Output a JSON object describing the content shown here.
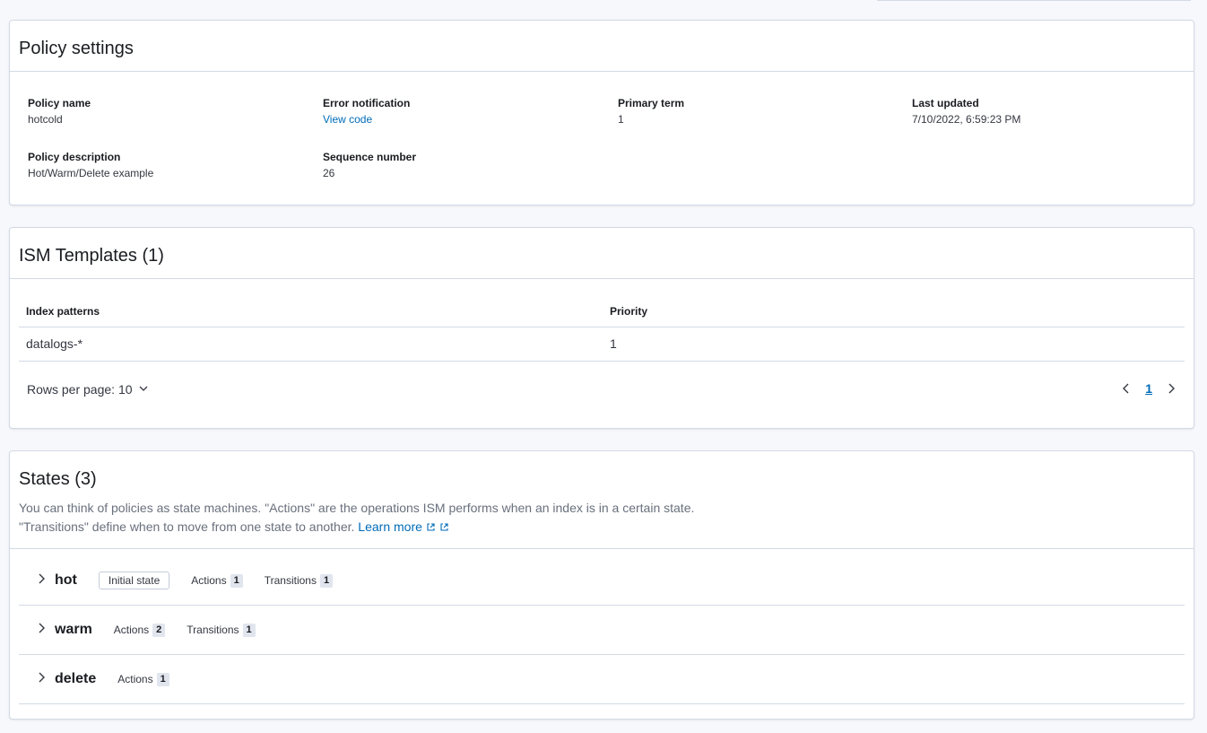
{
  "policy_settings": {
    "title": "Policy settings",
    "fields": {
      "policy_name": {
        "label": "Policy name",
        "value": "hotcold"
      },
      "error_notification": {
        "label": "Error notification",
        "value": "View code"
      },
      "primary_term": {
        "label": "Primary term",
        "value": "1"
      },
      "last_updated": {
        "label": "Last updated",
        "value": "7/10/2022, 6:59:23 PM"
      },
      "policy_description": {
        "label": "Policy description",
        "value": "Hot/Warm/Delete example"
      },
      "sequence_number": {
        "label": "Sequence number",
        "value": "26"
      }
    }
  },
  "ism_templates": {
    "title": "ISM Templates (1)",
    "columns": [
      "Index patterns",
      "Priority"
    ],
    "rows": [
      {
        "index_pattern": "datalogs-*",
        "priority": "1"
      }
    ],
    "rows_per_page_label": "Rows per page: 10",
    "current_page": "1"
  },
  "states": {
    "title": "States (3)",
    "description_line1": "You can think of policies as state machines. \"Actions\" are the operations ISM performs when an index is in a certain state.",
    "description_line2": "\"Transitions\" define when to move from one state to another.",
    "learn_more": "Learn more",
    "initial_state_label": "Initial state",
    "actions_label": "Actions",
    "transitions_label": "Transitions",
    "items": [
      {
        "name": "hot",
        "actions": "1",
        "transitions": "1"
      },
      {
        "name": "warm",
        "actions": "2",
        "transitions": "1"
      },
      {
        "name": "delete",
        "actions": "1"
      }
    ]
  },
  "colors": {
    "link": "#006bb8",
    "border": "#d3dae6",
    "background": "#f7f8fc"
  }
}
